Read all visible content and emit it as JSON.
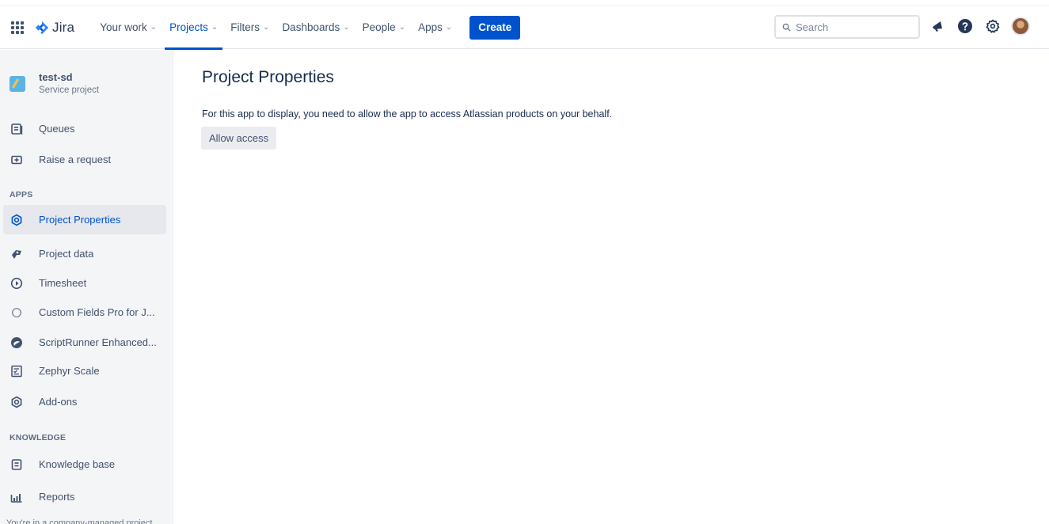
{
  "header": {
    "logo_text": "Jira",
    "nav": [
      {
        "label": "Your work",
        "chevron": "⌄"
      },
      {
        "label": "Projects",
        "chevron": "⌄"
      },
      {
        "label": "Filters",
        "chevron": "⌄"
      },
      {
        "label": "Dashboards",
        "chevron": "⌄"
      },
      {
        "label": "People",
        "chevron": "⌄"
      },
      {
        "label": "Apps",
        "chevron": "⌄"
      }
    ],
    "active_nav": "Projects",
    "create_label": "Create",
    "search_placeholder": "Search",
    "icons": [
      "notifications-icon",
      "help-icon",
      "settings-icon",
      "profile-avatar"
    ]
  },
  "sidebar": {
    "project_name": "test-sd",
    "project_type": "Service project",
    "items": [
      {
        "label": "Queues",
        "icon": "queues-icon"
      },
      {
        "label": "Raise a request",
        "icon": "raise-request-icon"
      }
    ],
    "apps_heading": "APPS",
    "apps": [
      {
        "label": "Project Properties",
        "icon": "project-properties-icon",
        "selected": true
      },
      {
        "label": "Project data",
        "icon": "project-data-icon"
      },
      {
        "label": "Timesheet",
        "icon": "timesheet-icon"
      },
      {
        "label": "Custom Fields Pro for J...",
        "icon": "custom-fields-icon"
      },
      {
        "label": "ScriptRunner Enhanced...",
        "icon": "scriptrunner-icon"
      },
      {
        "label": "Zephyr Scale",
        "icon": "zephyr-icon"
      },
      {
        "label": "Add-ons",
        "icon": "addons-icon"
      }
    ],
    "knowledge_heading": "KNOWLEDGE",
    "knowledge": [
      {
        "label": "Knowledge base",
        "icon": "knowledge-base-icon"
      },
      {
        "label": "Reports",
        "icon": "reports-icon"
      }
    ],
    "footer_text": "You're in a company-managed project"
  },
  "main": {
    "title": "Project Properties",
    "message": "For this app to display, you need to allow the app to access Atlassian products on your behalf.",
    "allow_button": "Allow access"
  },
  "colors": {
    "brand": "#0052cc",
    "sidebar_bg": "#f4f5f7",
    "text": "#172b4d",
    "muted": "#42526e"
  }
}
